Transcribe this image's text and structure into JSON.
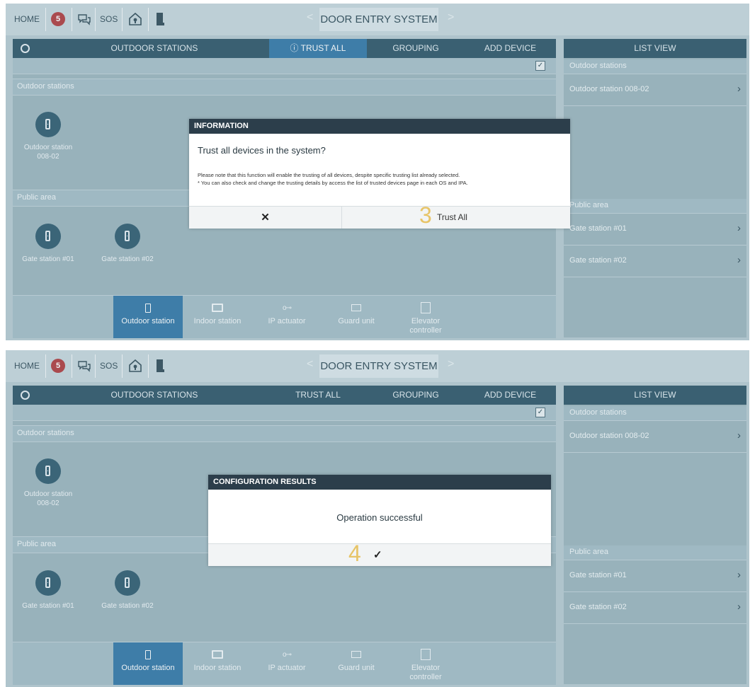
{
  "panels": [
    {
      "topbar": {
        "home": "HOME",
        "badge": "5",
        "sos": "SOS",
        "title": "DOOR ENTRY SYSTEM",
        "prev": "<",
        "next": ">"
      },
      "tabs": [
        "OUTDOOR STATIONS",
        "ⓘ TRUST ALL",
        "GROUPING",
        "ADD DEVICE"
      ],
      "active_tab": "ⓘ TRUST ALL",
      "sections": {
        "outdoor": "Outdoor stations",
        "outdoor_device": "Outdoor station\n008-02",
        "public": "Public area",
        "gate1": "Gate station #01",
        "gate2": "Gate station #02"
      },
      "bottom_tabs": [
        "Outdoor station",
        "Indoor station",
        "IP actuator",
        "Guard unit",
        "Elevator\ncontroller"
      ],
      "list": {
        "header": "LIST VIEW",
        "section1": "Outdoor stations",
        "item1": "Outdoor station 008-02",
        "section2": "Public area",
        "item2": "Gate station #01",
        "item3": "Gate station #02"
      },
      "dialog": {
        "header": "INFORMATION",
        "question": "Trust all devices in the system?",
        "note1": "Please note that this function will enable the trusting of all devices, despite specific trusting list already selected.",
        "note2": "* You can also check and change the trusting details by access the list of trusted devices page in each OS and IPA.",
        "cancel": "✕",
        "step": "3",
        "confirm": "Trust All"
      }
    },
    {
      "topbar": {
        "home": "HOME",
        "badge": "5",
        "sos": "SOS",
        "title": "DOOR ENTRY SYSTEM",
        "prev": "<",
        "next": ">"
      },
      "tabs": [
        "OUTDOOR STATIONS",
        "TRUST ALL",
        "GROUPING",
        "ADD DEVICE"
      ],
      "sections": {
        "outdoor": "Outdoor stations",
        "outdoor_device": "Outdoor station\n008-02",
        "public": "Public area",
        "gate1": "Gate station #01",
        "gate2": "Gate station #02"
      },
      "bottom_tabs": [
        "Outdoor station",
        "Indoor station",
        "IP actuator",
        "Guard unit",
        "Elevator\ncontroller"
      ],
      "list": {
        "header": "LIST VIEW",
        "section1": "Outdoor stations",
        "item1": "Outdoor station 008-02",
        "section2": "Public area",
        "item2": "Gate station #01",
        "item3": "Gate station #02"
      },
      "dialog": {
        "header": "CONFIGURATION RESULTS",
        "message": "Operation successful",
        "step": "4",
        "confirm": "✓"
      }
    }
  ],
  "colors": {
    "accent": "#3176a6",
    "dark": "#2c5467",
    "badge": "#b03a3c",
    "step": "#e7c467"
  },
  "icons": [
    "message-icon",
    "home-shield-icon",
    "door-icon",
    "radio-icon",
    "checkbox-icon",
    "device-icon",
    "monitor-icon",
    "key-icon",
    "guard-icon",
    "elevator-icon",
    "chevron-right-icon"
  ]
}
